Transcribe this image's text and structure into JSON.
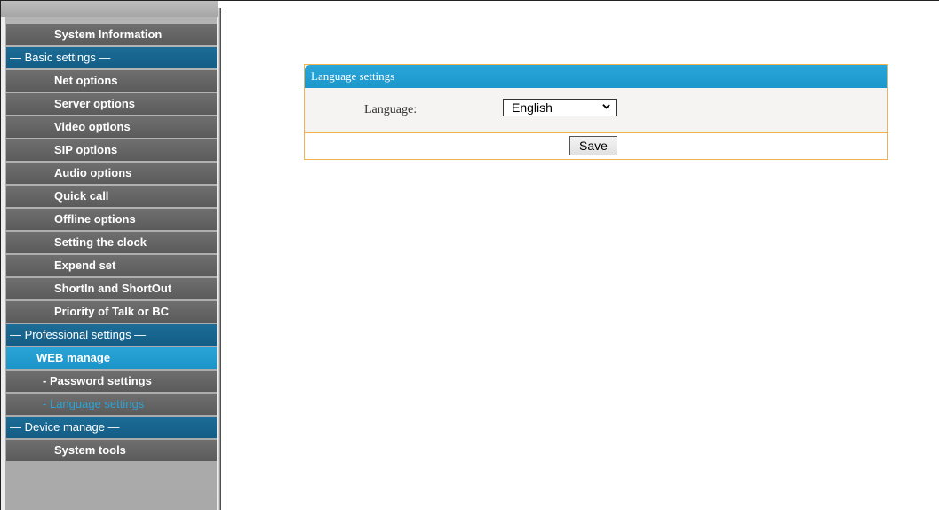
{
  "sidebar": {
    "items": [
      {
        "label": "System Information",
        "kind": "plain"
      },
      {
        "label": "— Basic settings —",
        "kind": "section"
      },
      {
        "label": "Net options",
        "kind": "plain"
      },
      {
        "label": "Server options",
        "kind": "plain"
      },
      {
        "label": "Video options",
        "kind": "plain"
      },
      {
        "label": "SIP options",
        "kind": "plain"
      },
      {
        "label": "Audio options",
        "kind": "plain"
      },
      {
        "label": "Quick call",
        "kind": "plain"
      },
      {
        "label": "Offline options",
        "kind": "plain"
      },
      {
        "label": "Setting the clock",
        "kind": "plain"
      },
      {
        "label": "Expend set",
        "kind": "plain"
      },
      {
        "label": "ShortIn and ShortOut",
        "kind": "plain"
      },
      {
        "label": "Priority of Talk or BC",
        "kind": "plain"
      },
      {
        "label": "— Professional settings —",
        "kind": "section"
      },
      {
        "label": "WEB manage",
        "kind": "active"
      },
      {
        "label": "- Password settings",
        "kind": "sub"
      },
      {
        "label": "- Language settings",
        "kind": "sub-active"
      },
      {
        "label": "— Device manage —",
        "kind": "section"
      },
      {
        "label": "System tools",
        "kind": "plain"
      }
    ]
  },
  "panel": {
    "title": "Language settings",
    "language_label": "Language:",
    "language_value": "English",
    "save_label": "Save"
  },
  "colors": {
    "header_blue": "#2ba6d9",
    "section_blue": "#1c6d97",
    "border_orange": "#f0b24d",
    "item_gray": "#6f6f6f"
  }
}
